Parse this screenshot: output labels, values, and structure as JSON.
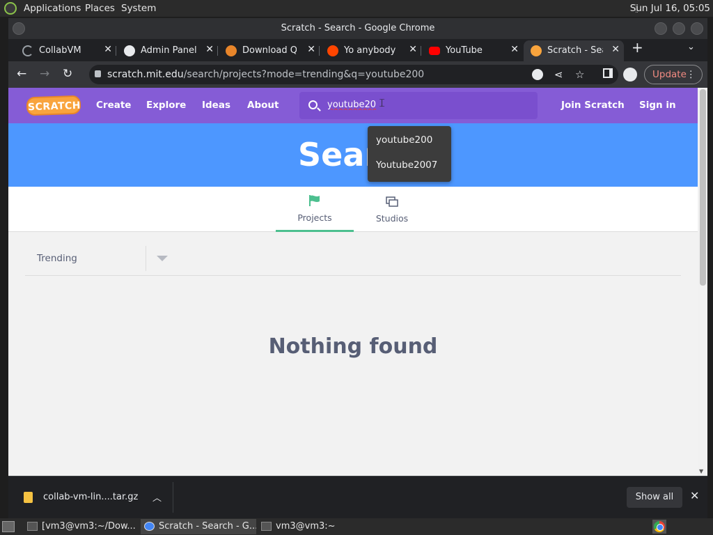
{
  "top_panel": {
    "applications": "Applications",
    "places": "Places",
    "system": "System",
    "clock": "Sun Jul 16, 05:05"
  },
  "window": {
    "title": "Scratch - Search - Google Chrome"
  },
  "tabs": [
    {
      "label": "CollabVM",
      "icon": "loading-icon"
    },
    {
      "label": "Admin Panel",
      "icon": "globe-icon"
    },
    {
      "label": "Download QEMU",
      "icon": "qemu-icon"
    },
    {
      "label": "Yo anybody got",
      "icon": "reddit-icon"
    },
    {
      "label": "YouTube",
      "icon": "youtube-icon"
    },
    {
      "label": "Scratch - Search",
      "icon": "scratch-icon"
    }
  ],
  "toolbar": {
    "url_host": "scratch.mit.edu",
    "url_path": "/search/projects?mode=trending&q=youtube200",
    "update_label": "Update"
  },
  "scratch_nav": {
    "logo": "SCRATCH",
    "create": "Create",
    "explore": "Explore",
    "ideas": "Ideas",
    "about": "About",
    "search_value": "youtube20",
    "join": "Join Scratch",
    "signin": "Sign in"
  },
  "suggestions": [
    "youtube200",
    "Youtube2007"
  ],
  "banner": {
    "title": "Search"
  },
  "search_tabs": {
    "projects": "Projects",
    "studios": "Studios"
  },
  "sort": {
    "selected": "Trending"
  },
  "results": {
    "empty_message": "Nothing found"
  },
  "downloads": {
    "file": "collab-vm-lin....tar.gz",
    "show_all": "Show all"
  },
  "taskbar": {
    "tasks": [
      "[vm3@vm3:~/Dow...",
      "Scratch - Search - G...",
      "vm3@vm3:~"
    ]
  },
  "colors": {
    "scratch_purple": "#855cd6",
    "scratch_blue": "#4d97ff",
    "tab_accent": "#4cbf8f"
  }
}
